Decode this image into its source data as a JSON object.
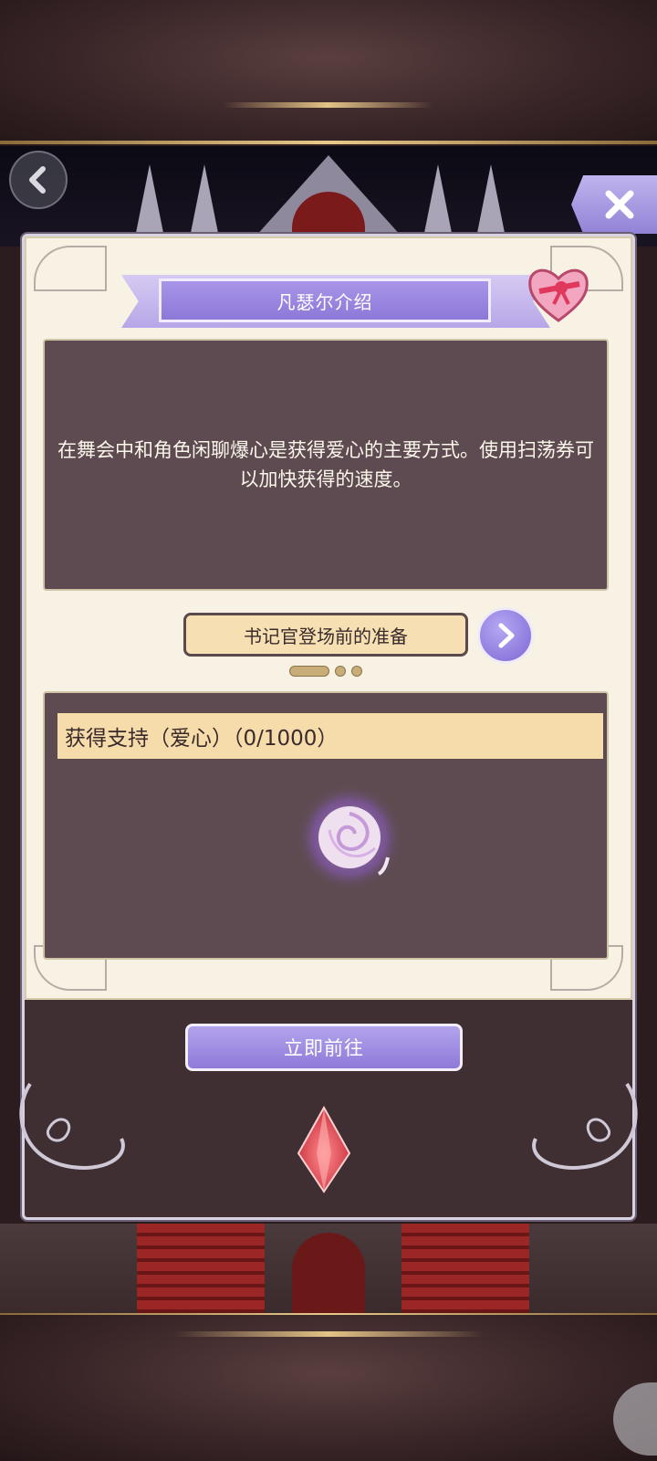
{
  "nav": {
    "back_icon": "chevron-left-icon",
    "close_icon": "close-icon"
  },
  "dialog": {
    "title": "凡瑟尔介绍",
    "description": "在舞会中和角色闲聊爆心是获得爱心的主要方式。使用扫荡券可以加快获得的速度。",
    "subtitle": "书记官登场前的准备",
    "pagination": {
      "current": 1,
      "total": 3
    },
    "reward_header": "获得支持（爱心）（0/1000）",
    "go_button": "立即前往"
  },
  "colors": {
    "accent_purple": "#9a86e0",
    "panel_dark": "#5e4b52",
    "card_bg": "#f8f2e4",
    "label_gold": "#f6dcaa"
  },
  "icons": [
    "heart-gift-icon",
    "rose-icon",
    "crystal-icon",
    "chevron-right-icon"
  ]
}
